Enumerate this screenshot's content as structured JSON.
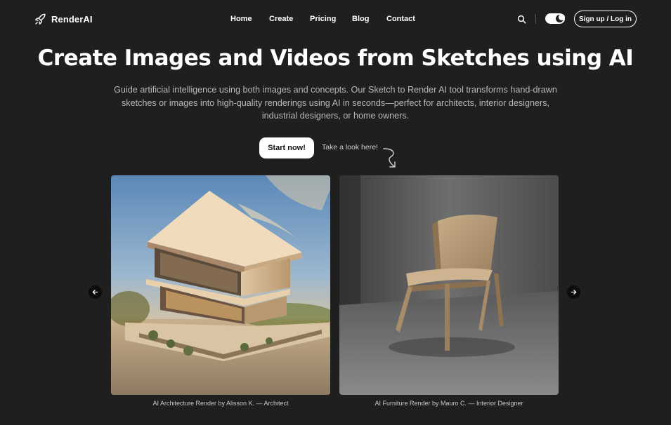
{
  "brand": {
    "name": "RenderAI",
    "logo_icon": "rocket-icon"
  },
  "nav": {
    "links": [
      {
        "label": "Home"
      },
      {
        "label": "Create"
      },
      {
        "label": "Pricing"
      },
      {
        "label": "Blog"
      },
      {
        "label": "Contact"
      }
    ],
    "search_icon": "search-icon",
    "theme_toggle_icon": "moon-icon",
    "signup_label": "Sign up / Log in"
  },
  "hero": {
    "title": "Create Images and Videos from Sketches using AI",
    "description": "Guide artificial intelligence using both images and concepts. Our Sketch to Render AI tool transforms hand-drawn sketches or images into high-quality renderings using AI in seconds—perfect for architects, interior designers, industrial designers, or home owners.",
    "cta_label": "Start now!",
    "look_label": "Take a look here!"
  },
  "gallery": {
    "items": [
      {
        "caption": "AI Architecture Render by Alisson K. — Architect"
      },
      {
        "caption": "AI Furniture Render by Mauro C. — Interior Designer"
      }
    ],
    "prev_icon": "arrow-left-icon",
    "next_icon": "arrow-right-icon"
  },
  "colors": {
    "background": "#1f1f1f",
    "text": "#ffffff",
    "muted_text": "#b8b8b8"
  }
}
